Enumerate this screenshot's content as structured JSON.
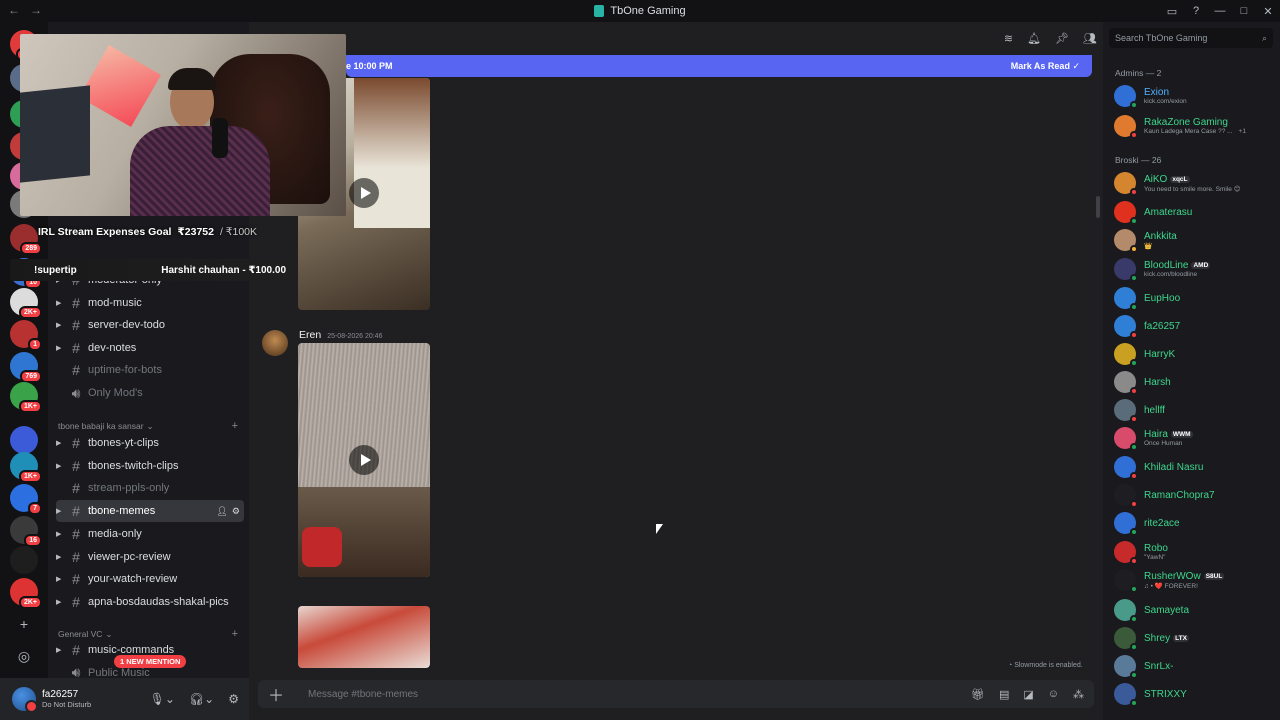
{
  "window": {
    "title": "TbOne Gaming"
  },
  "servers": [
    {
      "badge": "NEW",
      "color": "#e03a3a"
    },
    {
      "badge": "",
      "color": "#5b6b8a"
    },
    {
      "badge": "",
      "color": "#2f9e55"
    },
    {
      "badge": "",
      "color": "#c23b3b"
    },
    {
      "badge": "",
      "color": "#d76b9b"
    },
    {
      "badge": "",
      "color": "#7a7a7a"
    },
    {
      "badge": "289",
      "color": "#9a2d2d"
    },
    {
      "badge": "10",
      "color": "#3b6fd1"
    },
    {
      "badge": "2K+",
      "color": "#dcdcdc"
    },
    {
      "badge": "1",
      "color": "#b83232"
    },
    {
      "badge": "769",
      "color": "#2f76d3"
    },
    {
      "badge": "1K+",
      "color": "#3aa34a"
    },
    {
      "badge": "",
      "color": "#3b5bd8"
    },
    {
      "badge": "1K+",
      "color": "#1f8fb8"
    },
    {
      "badge": "7",
      "color": "#2b6fe0"
    },
    {
      "badge": "16",
      "color": "#3a3a3a"
    },
    {
      "badge": "",
      "color": "#1e1e1e"
    },
    {
      "badge": "2K+",
      "color": "#d33"
    }
  ],
  "channels": {
    "list1": [
      {
        "name": "moderator-only",
        "muted": false
      },
      {
        "name": "mod-music",
        "muted": false
      },
      {
        "name": "server-dev-todo",
        "muted": false
      },
      {
        "name": "dev-notes",
        "muted": false
      },
      {
        "name": "uptime-for-bots",
        "muted": true
      },
      {
        "name": "Only Mod's",
        "muted": true
      }
    ],
    "category2": "tbone babaji ka sansar",
    "list2": [
      {
        "name": "tbones-yt-clips",
        "muted": false
      },
      {
        "name": "tbones-twitch-clips",
        "muted": false
      },
      {
        "name": "stream-ppls-only",
        "muted": true
      },
      {
        "name": "tbone-memes",
        "muted": false,
        "active": true
      },
      {
        "name": "media-only",
        "muted": false
      },
      {
        "name": "viewer-pc-review",
        "muted": false
      },
      {
        "name": "your-watch-review",
        "muted": false
      },
      {
        "name": "apna-bosdaudas-shakal-pics",
        "muted": false
      }
    ],
    "category3": "General VC",
    "list3": [
      {
        "name": "music-commands",
        "muted": false
      },
      {
        "name": "Public Music",
        "muted": true
      }
    ]
  },
  "overlay": {
    "goal_label": "IRL Stream Expenses Goal",
    "goal_amount": "₹23752",
    "goal_target": "/ ₹100K",
    "tip_command": "!supertip",
    "tip_last": "Harshit chauhan - ₹100.00"
  },
  "mention_pill": "1 NEW MENTION",
  "user": {
    "name": "fa26257",
    "status": "Do Not Disturb"
  },
  "banner": {
    "text": "e 10:00 PM",
    "action": "Mark As Read"
  },
  "message": {
    "author": "Eren",
    "timestamp": "25-08-2026 20:46"
  },
  "composer": {
    "placeholder": "Message #tbone-memes"
  },
  "slowmode": "Slowmode is enabled.",
  "members": {
    "search_placeholder": "Search TbOne Gaming",
    "admins_header": "Admins — 2",
    "broski_header": "Broski — 26",
    "admins": [
      {
        "name": "Exion",
        "sub": "kick.com/exion",
        "color": "#4fb0ff",
        "avatar": "#2f6fd6",
        "status": "#23a55a"
      },
      {
        "name": "RakaZone Gaming",
        "sub": "Kaun Ladega Mera Case ?? ...",
        "extra": "+1",
        "color": "#3dd68c",
        "avatar": "#e07a2f",
        "status": "#f23f43"
      }
    ],
    "broski": [
      {
        "name": "AiKO",
        "tag": "xqcL",
        "sub": "You need to smile more. Smile 😊",
        "color": "#3dd68c",
        "avatar": "#d4862e",
        "status": "#f23f43"
      },
      {
        "name": "Amaterasu",
        "color": "#3dd68c",
        "avatar": "#e0301e",
        "status": "#23a55a"
      },
      {
        "name": "Ankkita",
        "sub": "👑",
        "color": "#3dd68c",
        "avatar": "#b48b6a",
        "status": "#f0b232"
      },
      {
        "name": "BloodLine",
        "tag": "AMD",
        "sub": "kick.com/bloodline",
        "color": "#3dd68c",
        "avatar": "#3a3a6a",
        "status": "#23a55a"
      },
      {
        "name": "EupHoo",
        "color": "#3dd68c",
        "avatar": "#2f7fd6",
        "status": "#23a55a"
      },
      {
        "name": "fa26257",
        "color": "#3dd68c",
        "avatar": "#2f7fd6",
        "status": "#f23f43"
      },
      {
        "name": "HarryK",
        "color": "#3dd68c",
        "avatar": "#c9a021",
        "status": "#23a55a"
      },
      {
        "name": "Harsh",
        "color": "#3dd68c",
        "avatar": "#8a8a8a",
        "status": "#f23f43"
      },
      {
        "name": "hellff",
        "color": "#3dd68c",
        "avatar": "#5a6b7a",
        "status": "#f23f43"
      },
      {
        "name": "Haira",
        "tag": "WWM",
        "sub": "Once Human",
        "color": "#3dd68c",
        "avatar": "#d94b6b",
        "status": "#23a55a"
      },
      {
        "name": "Khiladi Nasru",
        "color": "#3dd68c",
        "avatar": "#2f6fd6",
        "status": "#f23f43"
      },
      {
        "name": "RamanChopra7",
        "color": "#3dd68c",
        "avatar": "#1e1e22",
        "status": "#f23f43"
      },
      {
        "name": "rite2ace",
        "color": "#3dd68c",
        "avatar": "#2f6fd6",
        "status": "#23a55a"
      },
      {
        "name": "Robo",
        "sub": "\"YawN\"",
        "color": "#3dd68c",
        "avatar": "#c62a2a",
        "status": "#f23f43"
      },
      {
        "name": "RusherWOw",
        "tag": "S8UL",
        "sub": "♫ • ❤️ FOREVER!",
        "color": "#3dd68c",
        "avatar": "#1e1e22",
        "status": "#23a55a"
      },
      {
        "name": "Samayeta",
        "color": "#3dd68c",
        "avatar": "#4a9a8a",
        "status": "#23a55a"
      },
      {
        "name": "Shrey",
        "tag": "LTX",
        "color": "#3dd68c",
        "avatar": "#3a5a3a",
        "status": "#23a55a"
      },
      {
        "name": "SnrLx-",
        "color": "#3dd68c",
        "avatar": "#5a7a9a",
        "status": "#23a55a"
      },
      {
        "name": "STRIXXY",
        "color": "#3dd68c",
        "avatar": "#3a5a9a",
        "status": "#23a55a"
      }
    ]
  }
}
